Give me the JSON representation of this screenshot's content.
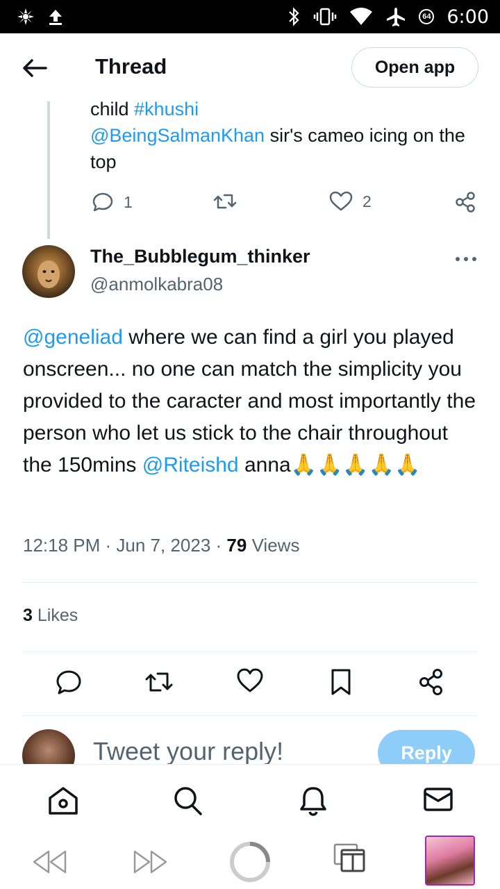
{
  "status_bar": {
    "time": "6:00",
    "badge": "64"
  },
  "header": {
    "title": "Thread",
    "open_app_label": "Open app"
  },
  "previous_tweet": {
    "line1_plain": "child ",
    "line1_hashtag": "#khushi",
    "mention": "@BeingSalmanKhan",
    "rest": " sir's cameo icing on the top",
    "reply_count": "1",
    "like_count": "2"
  },
  "tweet": {
    "display_name": "The_Bubblegum_thinker",
    "handle": "@anmolkabra08",
    "mention1": "@geneliad",
    "body": " where we can find a girl you played onscreen... no one can match the simplicity you provided to the caracter and most importantly the person who let us stick to the chair throughout the 150mins ",
    "mention2": "@Riteishd",
    "tail": " anna🙏🙏🙏🙏🙏",
    "time": "12:18 PM",
    "date": "Jun 7, 2023",
    "views_count": "79",
    "views_label": "Views",
    "likes_count": "3",
    "likes_label": "Likes"
  },
  "reply": {
    "placeholder": "Tweet your reply!",
    "button": "Reply"
  },
  "colors": {
    "link": "#1d9bf0",
    "muted": "#536471",
    "reply_button": "#8ecdf8"
  },
  "icons": {
    "nav": [
      "home-icon",
      "search-icon",
      "notifications-icon",
      "messages-icon"
    ],
    "browser": [
      "back-icon",
      "forward-icon",
      "reload-icon",
      "tabs-icon"
    ]
  }
}
